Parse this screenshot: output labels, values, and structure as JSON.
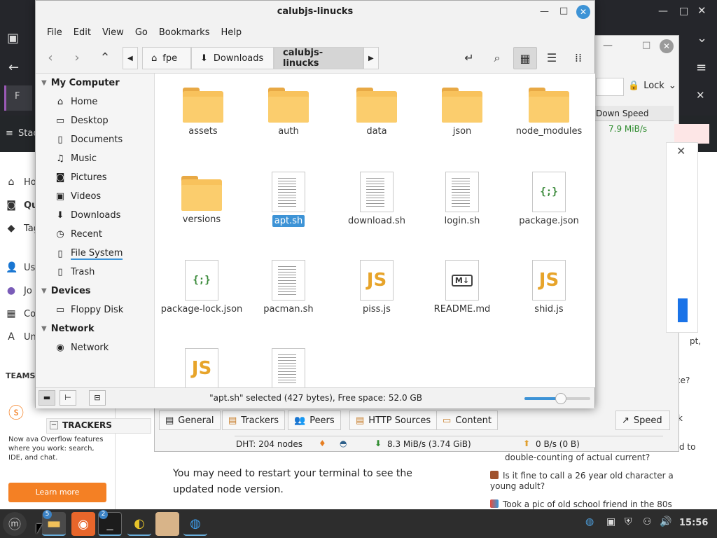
{
  "file_manager": {
    "title": "calubjs-linucks",
    "menu": [
      "File",
      "Edit",
      "View",
      "Go",
      "Bookmarks",
      "Help"
    ],
    "breadcrumbs": [
      "fpe",
      "Downloads",
      "calubjs-linucks"
    ],
    "sidebar": {
      "my_computer": {
        "heading": "My Computer",
        "items": [
          "Home",
          "Desktop",
          "Documents",
          "Music",
          "Pictures",
          "Videos",
          "Downloads",
          "Recent",
          "File System",
          "Trash"
        ]
      },
      "devices": {
        "heading": "Devices",
        "items": [
          "Floppy Disk"
        ]
      },
      "network": {
        "heading": "Network",
        "items": [
          "Network"
        ]
      }
    },
    "files": [
      {
        "name": "assets",
        "kind": "folder"
      },
      {
        "name": "auth",
        "kind": "folder"
      },
      {
        "name": "data",
        "kind": "folder"
      },
      {
        "name": "json",
        "kind": "folder"
      },
      {
        "name": "node_modules",
        "kind": "folder"
      },
      {
        "name": "versions",
        "kind": "folder"
      },
      {
        "name": "apt.sh",
        "kind": "text",
        "selected": true
      },
      {
        "name": "download.sh",
        "kind": "text"
      },
      {
        "name": "login.sh",
        "kind": "text"
      },
      {
        "name": "package.json",
        "kind": "json"
      },
      {
        "name": "package-lock.json",
        "kind": "json"
      },
      {
        "name": "pacman.sh",
        "kind": "text"
      },
      {
        "name": "piss.js",
        "kind": "js"
      },
      {
        "name": "README.md",
        "kind": "md"
      },
      {
        "name": "shid.js",
        "kind": "js"
      },
      {
        "name": "",
        "kind": "js"
      },
      {
        "name": "",
        "kind": "text"
      }
    ],
    "status_text": "\"apt.sh\" selected (427 bytes), Free space: 52.0 GB",
    "zoom_level": 0.55
  },
  "torrent_client": {
    "lock_label": "Lock",
    "column_header": "Down Speed",
    "down_speed_value": "7.9 MiB/s",
    "tabs": [
      "General",
      "Trackers",
      "Peers",
      "HTTP Sources",
      "Content"
    ],
    "speed_button": "Speed",
    "trackers_label": "TRACKERS",
    "status": {
      "dht": "DHT: 204 nodes",
      "download": "8.3 MiB/s (3.74 GiB)",
      "upload": "0 B/s (0 B)"
    }
  },
  "browser_page": {
    "left_nav": [
      "Hom",
      "Qu",
      "Tag",
      "Use",
      "Jo",
      "Co",
      "Un"
    ],
    "teams_label": "TEAMS",
    "teams_ad": "Now ava Overflow features where you work: search, IDE, and chat.",
    "learn_more": "Learn more",
    "answer_text": "You may need to restart your terminal to see the updated node version.",
    "right_fragments": [
      "pt,",
      "ce?",
      "k",
      "d to"
    ],
    "hot_questions": [
      "double-counting of actual current?",
      "Is it fine to call a 26 year old character a young adult?",
      "Took a pic of old school friend in the 80s who is"
    ]
  },
  "taskbar": {
    "clock": "15:56",
    "badges": [
      "5",
      "2"
    ]
  }
}
